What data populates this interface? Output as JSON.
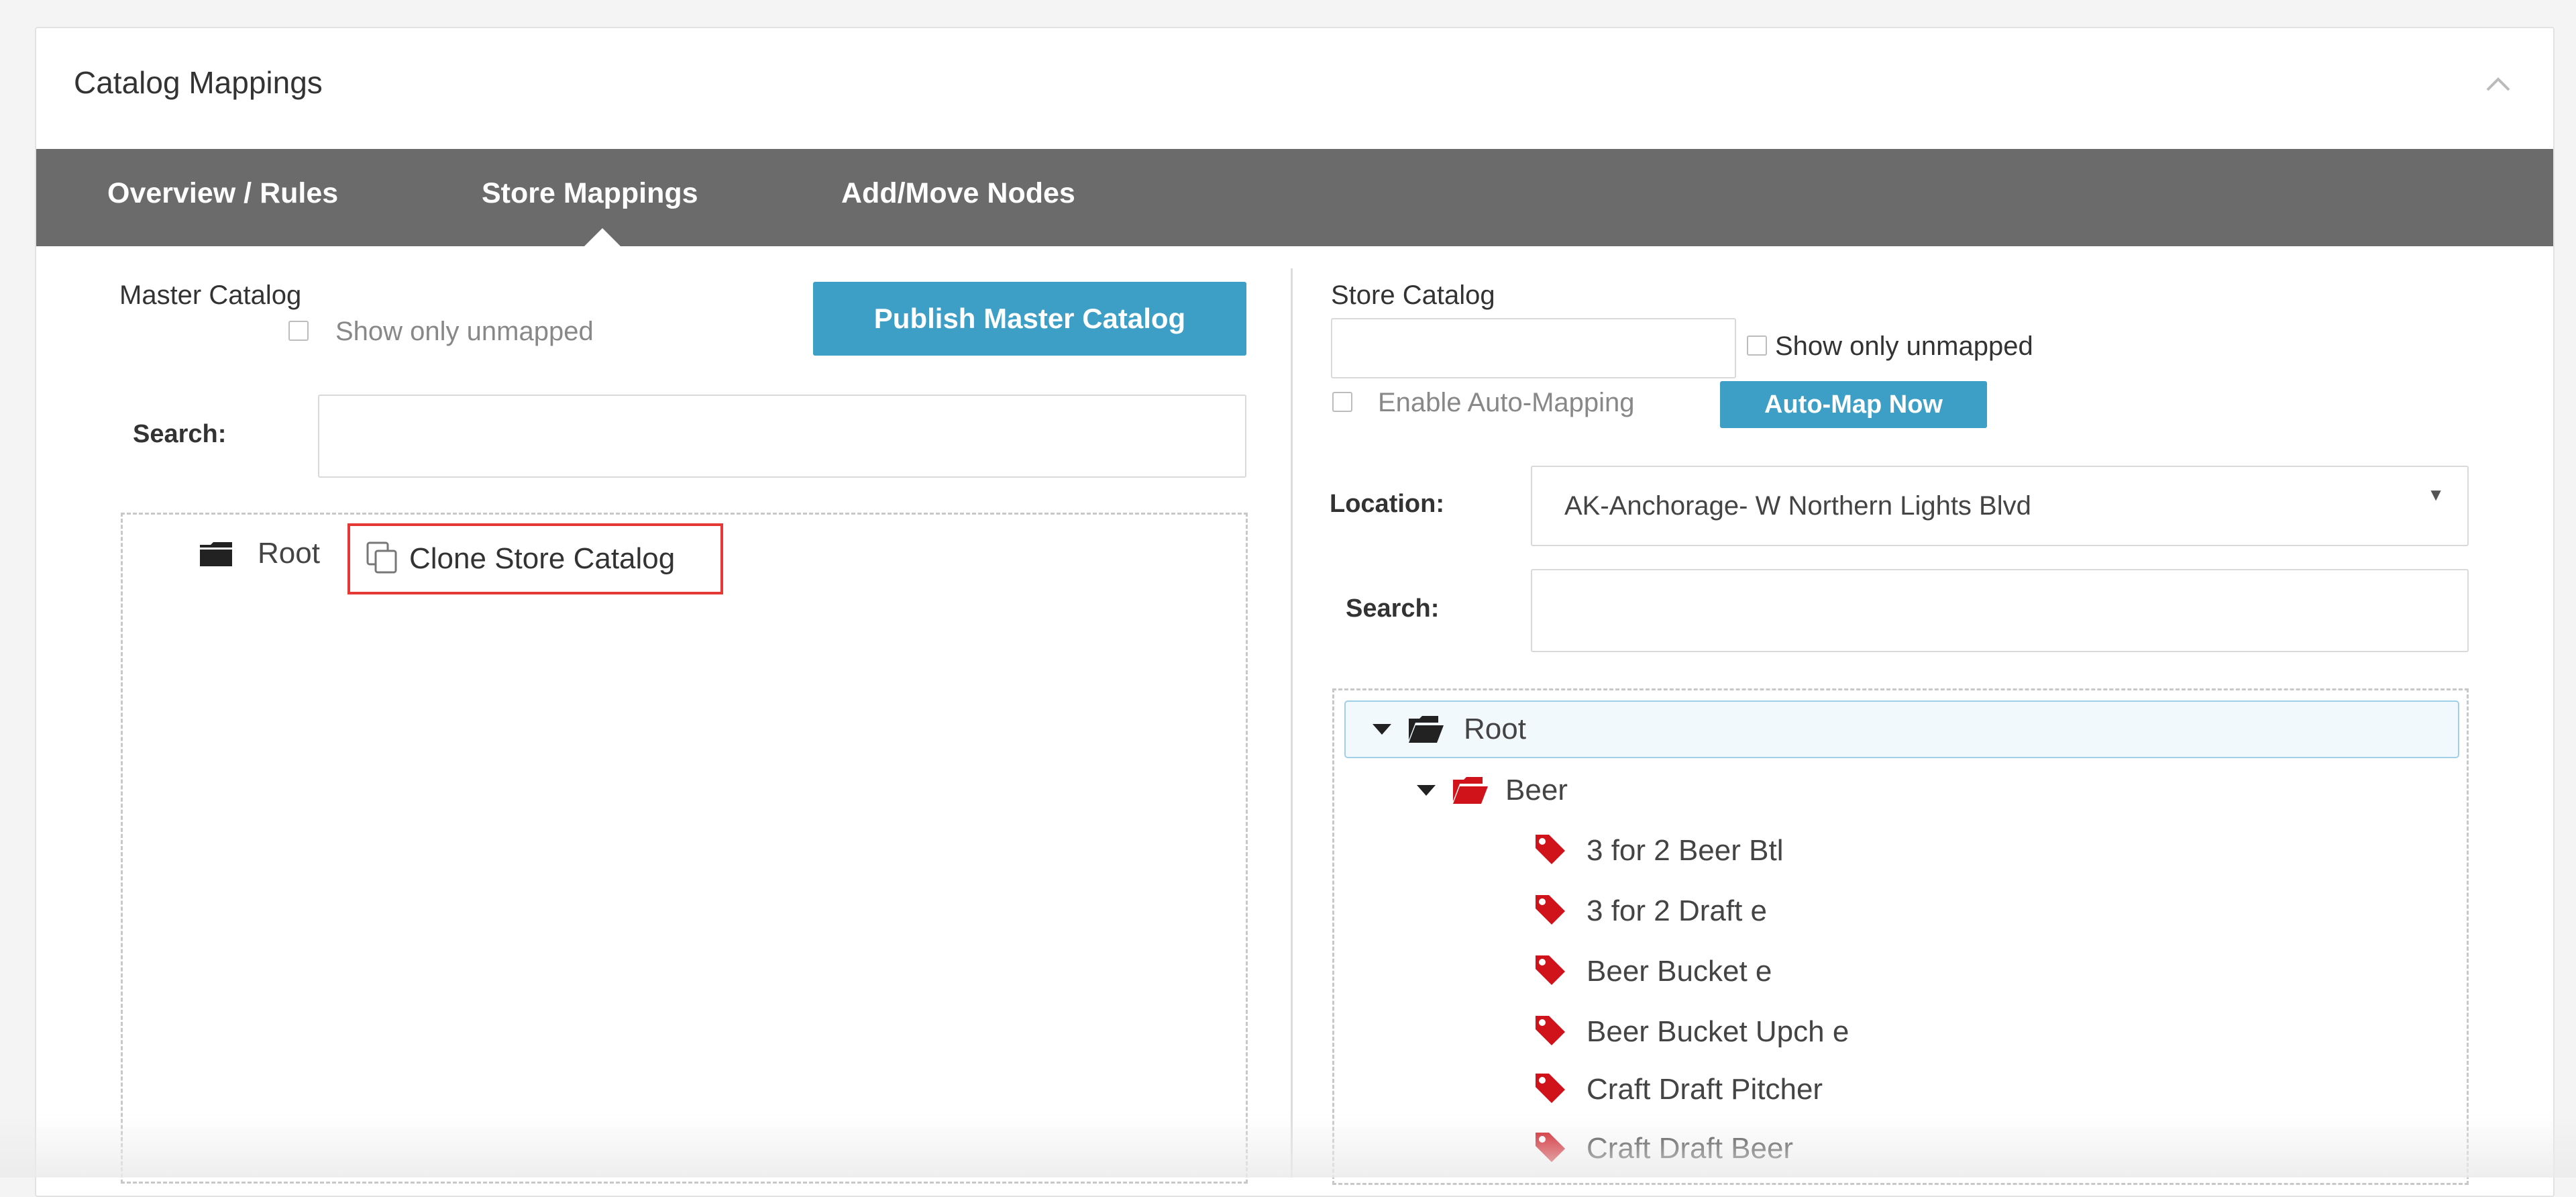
{
  "panel": {
    "title": "Catalog Mappings"
  },
  "tabs": [
    {
      "label": "Overview / Rules",
      "active": false
    },
    {
      "label": "Store Mappings",
      "active": true
    },
    {
      "label": "Add/Move Nodes",
      "active": false
    }
  ],
  "master": {
    "title": "Master Catalog",
    "show_unmapped_label": "Show only unmapped",
    "publish_label": "Publish Master Catalog",
    "search_label": "Search:",
    "search_value": "",
    "tree_root": "Root",
    "clone_label": "Clone Store Catalog"
  },
  "store": {
    "title": "Store Catalog",
    "filter_value": "",
    "show_unmapped_label": "Show only unmapped",
    "auto_mapping_label": "Enable Auto-Mapping",
    "automap_label": "Auto-Map Now",
    "location_label": "Location:",
    "location_value": "AK-Anchorage- W Northern Lights Blvd",
    "search_label": "Search:",
    "search_value": "",
    "tree": {
      "root": "Root",
      "folder": "Beer",
      "items": [
        "3 for 2 Beer Btl",
        "3 for 2 Draft e",
        "Beer Bucket e",
        "Beer Bucket Upch e",
        "Craft Draft Pitcher",
        "Craft Draft Beer"
      ]
    }
  },
  "colors": {
    "accent": "#3d9fc6",
    "tabbar": "#6b6b6b",
    "highlight": "#e53935",
    "tag": "#d0121b"
  },
  "icons": {
    "collapse": "chevron-up-icon",
    "folder": "folder-icon",
    "folder_open": "folder-open-icon",
    "copy": "copy-icon",
    "tag": "tag-icon"
  }
}
